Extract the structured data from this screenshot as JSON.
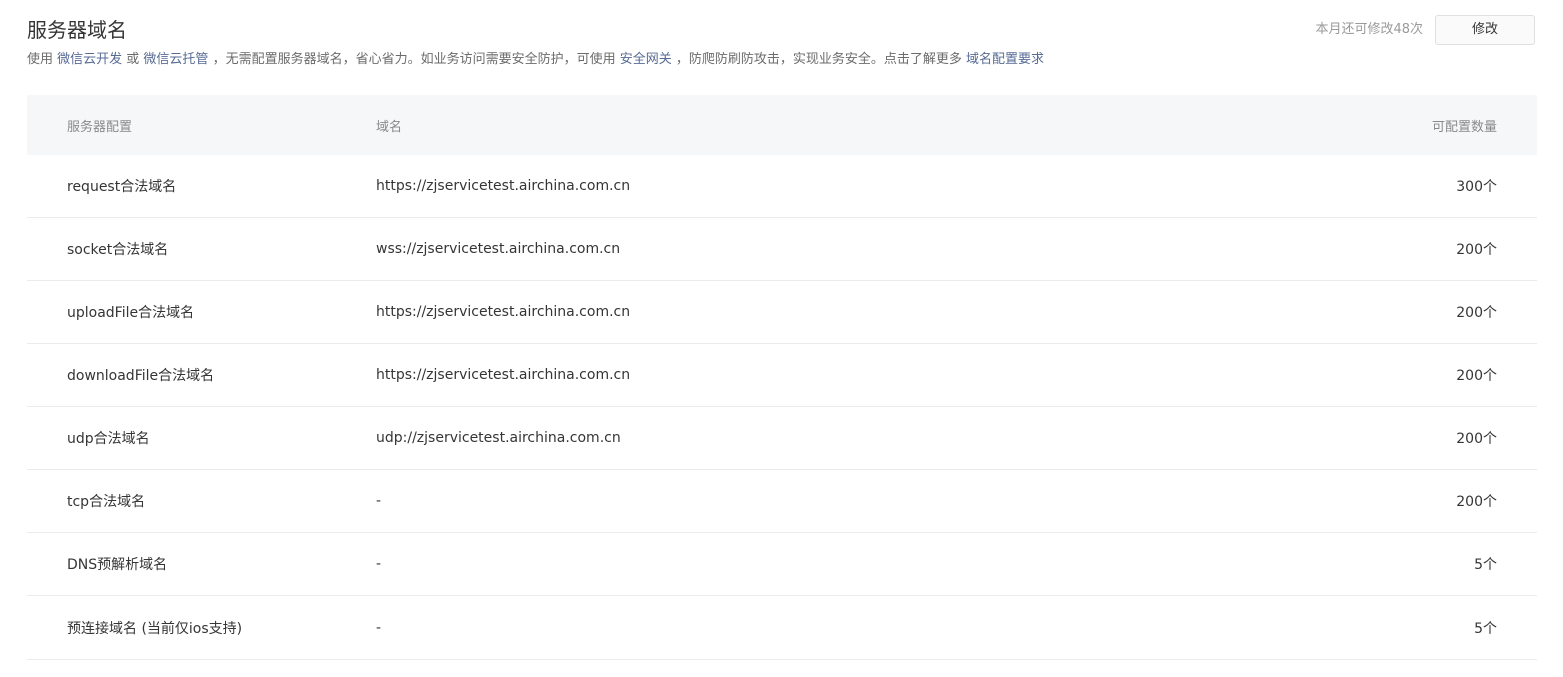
{
  "header": {
    "title": "服务器域名",
    "quota_text": "本月还可修改48次",
    "edit_label": "修改"
  },
  "description": {
    "p1": "使用 ",
    "link1": "微信云开发",
    "p2": " 或 ",
    "link2": "微信云托管",
    "p3": " ，无需配置服务器域名，省心省力。如业务访问需要安全防护，可使用 ",
    "link3": "安全网关",
    "p4": " ，防爬防刷防攻击，实现业务安全。点击了解更多 ",
    "link4": "域名配置要求",
    "link_color": "#576b95"
  },
  "table": {
    "headers": [
      "服务器配置",
      "域名",
      "可配置数量"
    ],
    "rows": [
      {
        "config": "request合法域名",
        "domain": "https://zjservicetest.airchina.com.cn",
        "count": "300个"
      },
      {
        "config": "socket合法域名",
        "domain": "wss://zjservicetest.airchina.com.cn",
        "count": "200个"
      },
      {
        "config": "uploadFile合法域名",
        "domain": "https://zjservicetest.airchina.com.cn",
        "count": "200个"
      },
      {
        "config": "downloadFile合法域名",
        "domain": "https://zjservicetest.airchina.com.cn",
        "count": "200个"
      },
      {
        "config": "udp合法域名",
        "domain": "udp://zjservicetest.airchina.com.cn",
        "count": "200个"
      },
      {
        "config": "tcp合法域名",
        "domain": "-",
        "count": "200个"
      },
      {
        "config": "DNS预解析域名",
        "domain": "-",
        "count": "5个"
      },
      {
        "config": "预连接域名 (当前仅ios支持)",
        "domain": "-",
        "count": "5个"
      }
    ]
  }
}
